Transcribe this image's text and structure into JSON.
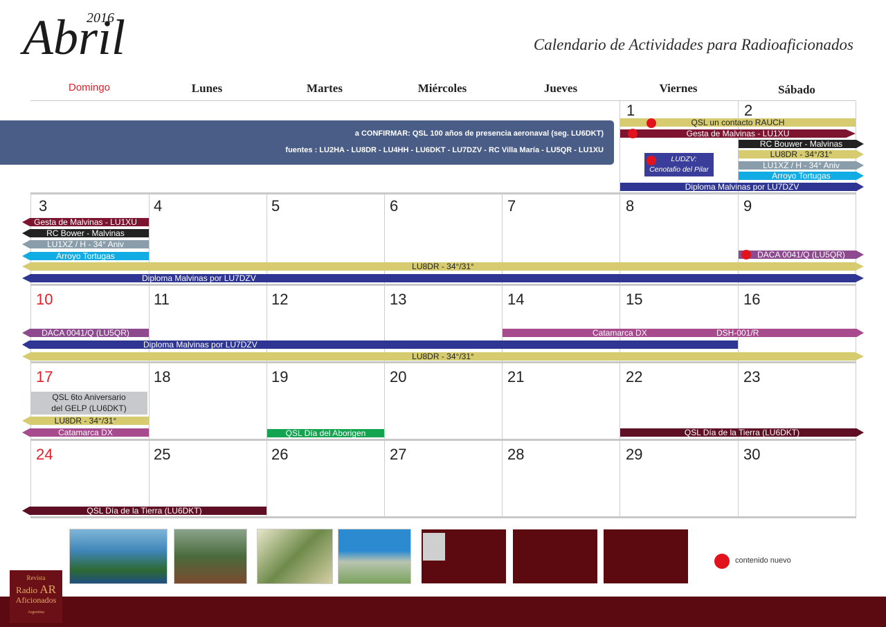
{
  "header": {
    "month": "Abril",
    "year": "2016",
    "subtitle": "Calendario de Actividades para Radioaficionados"
  },
  "weekdays": [
    "Domingo",
    "Lunes",
    "Martes",
    "Miércoles",
    "Jueves",
    "Viernes",
    "Sábado"
  ],
  "days": {
    "d1": "1",
    "d2": "2",
    "d3": "3",
    "d4": "4",
    "d5": "5",
    "d6": "6",
    "d7": "7",
    "d8": "8",
    "d9": "9",
    "d10": "10",
    "d11": "11",
    "d12": "12",
    "d13": "13",
    "d14": "14",
    "d15": "15",
    "d16": "16",
    "d17": "17",
    "d18": "18",
    "d19": "19",
    "d20": "20",
    "d21": "21",
    "d22": "22",
    "d23": "23",
    "d24": "24",
    "d25": "25",
    "d26": "26",
    "d27": "27",
    "d28": "28",
    "d29": "29",
    "d30": "30"
  },
  "banner": {
    "line1": "a CONFIRMAR:    QSL 100 años de presencia aeronaval (seg. LU6DKT)",
    "line2": "fuentes :  LU2HA - LU8DR - LU4HH - LU6DKT - LU7DZV - RC Villa María - LU5QR - LU1XU"
  },
  "events": {
    "qsl_rauch": "QSL un contacto RAUCH",
    "gesta": "Gesta de Malvinas  - LU1XU",
    "rc_bouwer_w1": "RC Bouwer - Malvinas",
    "lu8dr_w1": "LU8DR - 34°/31°",
    "lu1xz_w1": "LU1XZ / H - 34° Aniv",
    "arroyo_w1": "Arroyo Tortugas",
    "diploma": "Diploma Malvinas por LU7DZV",
    "ludzv": "LUDZV:",
    "cenotafio": "Cenotafio del Pilar",
    "gesta_w2": "Gesta de Malvinas  - LU1XU",
    "rc_bouwer_w2": "RC Bower - Malvinas",
    "lu1xz_w2": "LU1XZ / H - 34° Aniv",
    "arroyo_w2": "Arroyo Tortugas",
    "lu8dr": "LU8DR - 34°/31°",
    "daca": "DACA 0041/Q (LU5QR)",
    "catamarca": "Catamarca DX",
    "dsh": "DSH-001/R",
    "qsl_gelp_1": "QSL 6to Aniversario",
    "qsl_gelp_2": "del GELP (LU6DKT)",
    "qsl_aborigen": "QSL Día del Aborigen",
    "qsl_tierra": "QSL Día de la Tierra (LU6DKT)"
  },
  "colors": {
    "gold": "#d6cb6f",
    "maroon": "#7e1530",
    "black": "#222222",
    "steel": "#8a9dab",
    "cyan": "#11ace4",
    "navy": "#2e3592",
    "purple": "#8d4a8f",
    "magenta": "#a74a8e",
    "green": "#14a34f",
    "darkred": "#5e0f24",
    "banner": "#4a5d87",
    "dot": "#e1141e"
  },
  "legend": {
    "text": "contenido nuevo"
  },
  "logo": {
    "line1": "Revista",
    "line2": "Radio",
    "line3": "AR",
    "line4": "Aficionados",
    "line5": "Argentina"
  }
}
